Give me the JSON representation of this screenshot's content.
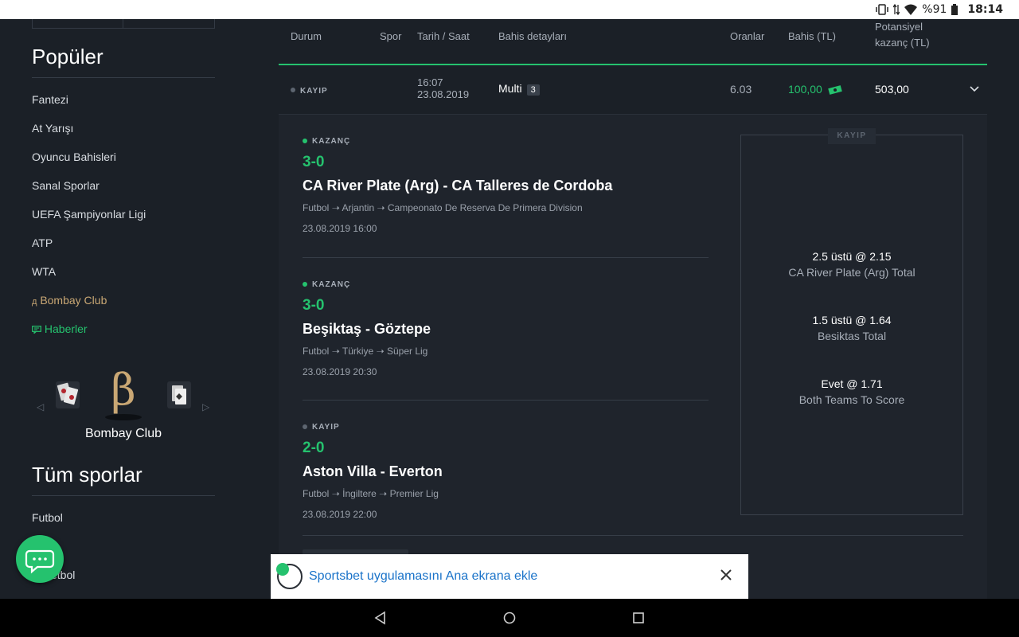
{
  "statusbar": {
    "battery": "%91",
    "time": "18:14"
  },
  "sidebar": {
    "popular_title": "Popüler",
    "items": [
      {
        "label": "Fantezi"
      },
      {
        "label": "At Yarışı"
      },
      {
        "label": "Oyuncu Bahisleri"
      },
      {
        "label": "Sanal Sporlar"
      },
      {
        "label": "UEFA Şampiyonlar Ligi"
      },
      {
        "label": "ATP"
      },
      {
        "label": "WTA"
      },
      {
        "label": "Bombay Club",
        "icon": "bombay-icon",
        "color": "#c9a774"
      },
      {
        "label": "Haberler",
        "icon": "news-icon",
        "color": "#25c26e"
      }
    ],
    "carousel_label": "Bombay Club",
    "all_sports_title": "Tüm sporlar",
    "sports": [
      {
        "label": "Futbol"
      },
      {
        "label": "etbol"
      }
    ]
  },
  "table": {
    "headers": {
      "status": "Durum",
      "sport": "Spor",
      "datetime": "Tarih / Saat",
      "details": "Bahis detayları",
      "odds": "Oranlar",
      "stake": "Bahis (TL)",
      "potential_1": "Potansiyel",
      "potential_2": "kazanç (TL)"
    },
    "bet": {
      "status": "KAYIP",
      "time": "16:07",
      "date": "23.08.2019",
      "type": "Multi",
      "count": "3",
      "odds": "6.03",
      "stake": "100,00",
      "potential": "503,00"
    }
  },
  "legs": [
    {
      "status": "KAZANÇ",
      "score": "3-0",
      "title": "CA River Plate (Arg) - CA Talleres de Cordoba",
      "sport": "Futbol",
      "country": "Arjantin",
      "league": "Campeonato De Reserva De Primera Division",
      "date": "23.08.2019 16:00",
      "won": true
    },
    {
      "status": "KAZANÇ",
      "score": "3-0",
      "title": "Beşiktaş - Göztepe",
      "sport": "Futbol",
      "country": "Türkiye",
      "league": "Süper Lig",
      "date": "23.08.2019 20:30",
      "won": true
    },
    {
      "status": "KAYIP",
      "score": "2-0",
      "title": "Aston Villa - Everton",
      "sport": "Futbol",
      "country": "İngiltere",
      "league": "Premier Lig",
      "date": "23.08.2019 22:00",
      "won": false
    }
  ],
  "slip": {
    "tag": "KAYIP",
    "selections": [
      {
        "pick": "2.5 üstü @ 2.15",
        "market": "CA River Plate (Arg) Total"
      },
      {
        "pick": "1.5 üstü @ 1.64",
        "market": "Besiktas Total"
      },
      {
        "pick": "Evet @ 1.71",
        "market": "Both Teams To Score"
      }
    ]
  },
  "toast": {
    "text": "Sportsbet uygulamasını Ana ekrana ekle"
  },
  "colors": {
    "accent": "#25c26e",
    "gold": "#c9a774",
    "background": "#1b2027",
    "panel": "#1f242c"
  }
}
